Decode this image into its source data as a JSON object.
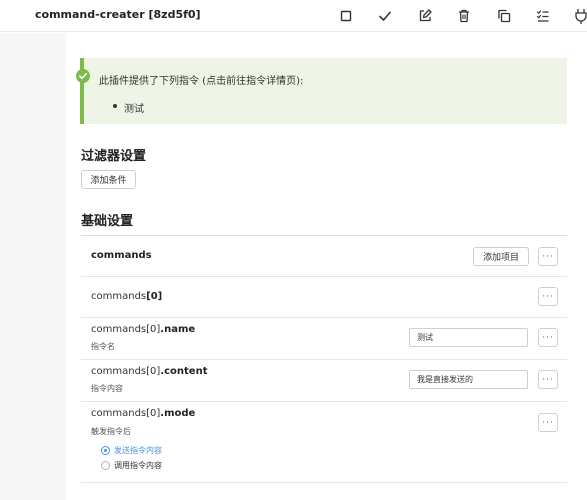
{
  "window": {
    "title": "command-creater [8zd5f0]",
    "toolbar_icons": [
      "square-icon",
      "check-icon",
      "edit-icon",
      "trash-icon",
      "copy-icon",
      "list-check-icon",
      "plug-icon"
    ]
  },
  "notice": {
    "text": "此插件提供了下列指令 (点击前往指令详情页):",
    "items": [
      "测试"
    ],
    "accent": "#7fba4a"
  },
  "filter_section": {
    "title": "过滤器设置",
    "add_condition_label": "添加条件"
  },
  "basic_section": {
    "title": "基础设置",
    "commands_key": "commands",
    "add_item_label": "添加项目",
    "more_label": "···",
    "index_key": {
      "prefix": "commands",
      "suffix": "[0]"
    },
    "name_field": {
      "prefix": "commands[0]",
      "suffix": ".name",
      "desc": "指令名",
      "value": "测试"
    },
    "content_field": {
      "prefix": "commands[0]",
      "suffix": ".content",
      "desc": "指令内容",
      "value": "我是直接发送的"
    },
    "mode_field": {
      "prefix": "commands[0]",
      "suffix": ".mode",
      "desc": "触发指令后",
      "options": [
        {
          "label": "发送指令内容",
          "selected": true
        },
        {
          "label": "调用指令内容",
          "selected": false
        }
      ]
    }
  },
  "colors": {
    "selected": "#4a90e2",
    "success": "#7fba4a"
  }
}
